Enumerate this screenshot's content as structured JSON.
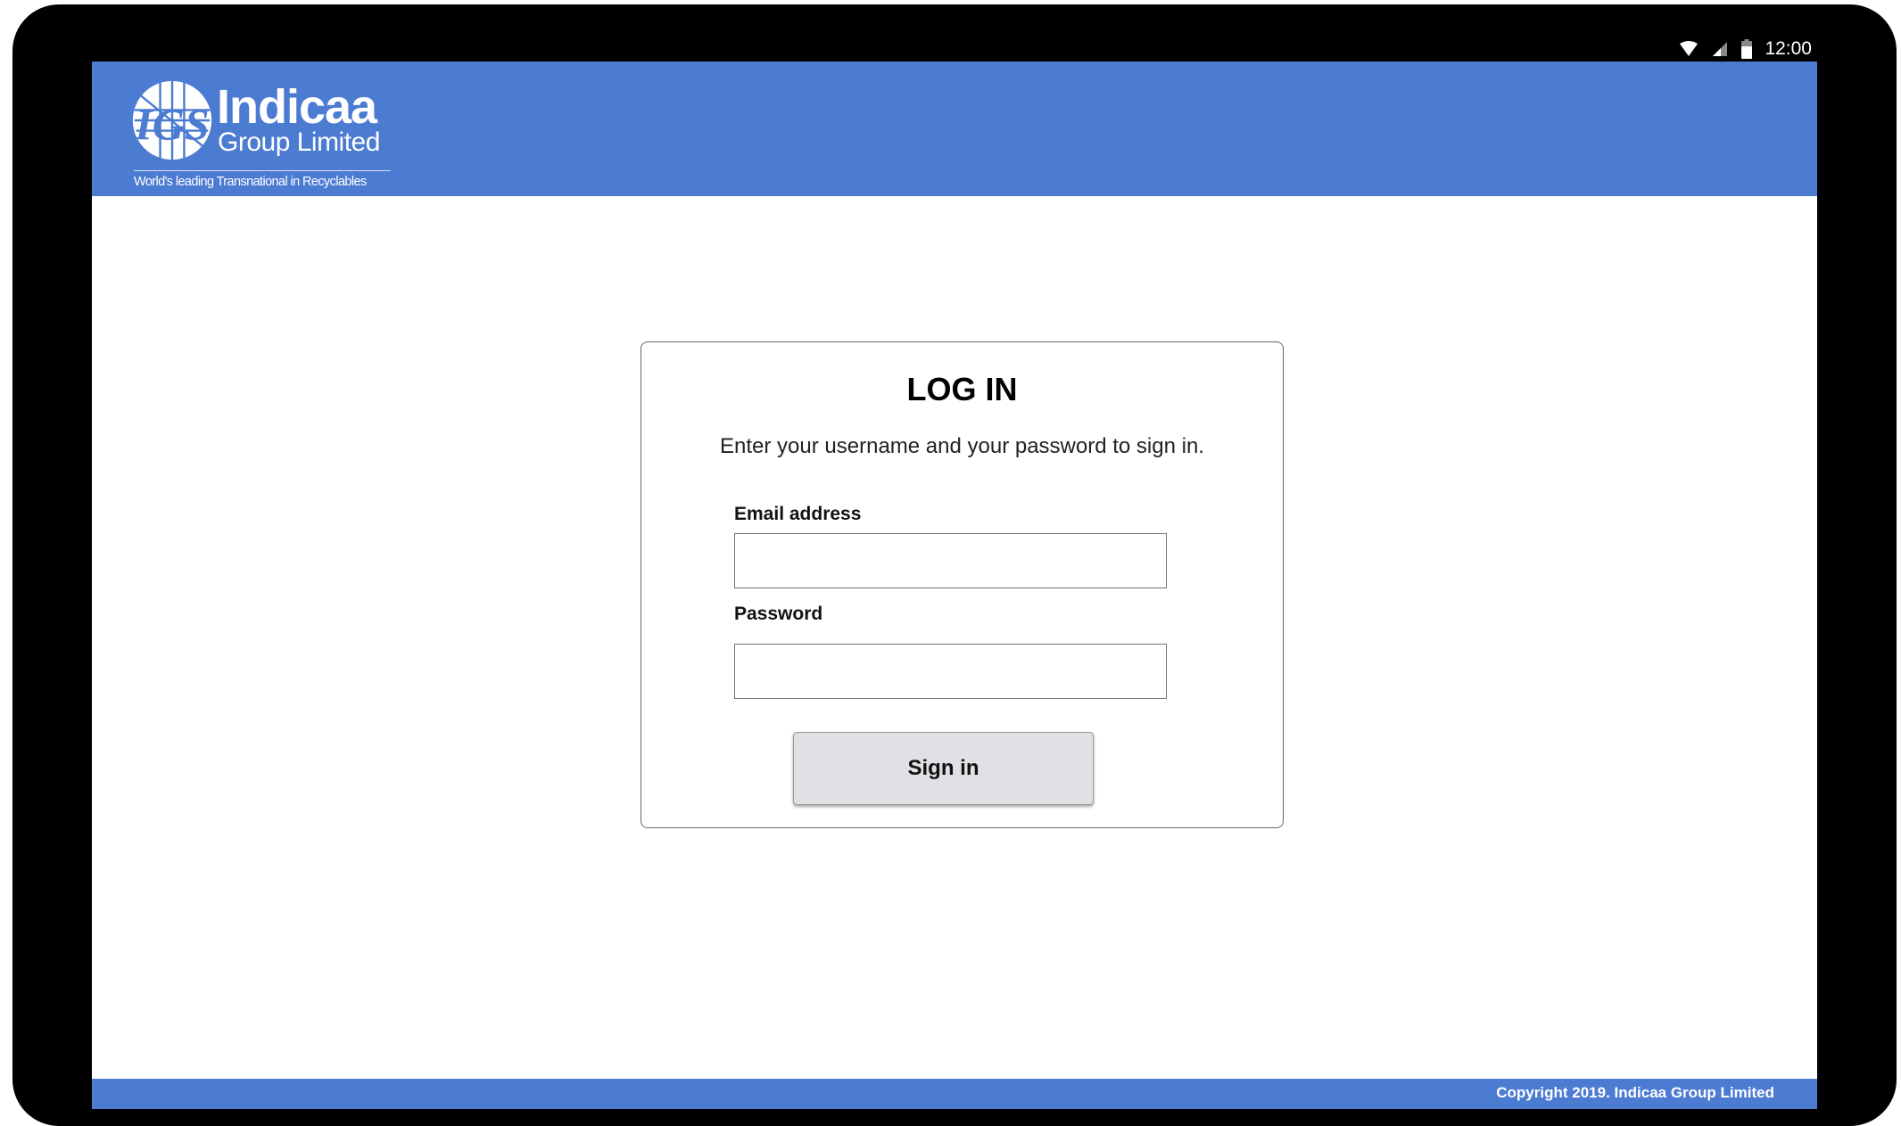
{
  "status_bar": {
    "time": "12:00",
    "icons": [
      "wifi-icon",
      "signal-icon",
      "battery-icon"
    ]
  },
  "header": {
    "logo": {
      "monogram": "IGS",
      "brand": "Indicaa",
      "subtitle": "Group Limited",
      "tagline": "World's leading Transnational in Recyclables"
    },
    "background_color": "#4c7bd2"
  },
  "login": {
    "title": "LOG IN",
    "subtitle": "Enter your username and your password to sign in.",
    "email_label": "Email address",
    "email_value": "",
    "password_label": "Password",
    "password_value": "",
    "submit_label": "Sign in"
  },
  "footer": {
    "copyright": "Copyright 2019. Indicaa Group Limited",
    "background_color": "#4c7bd2"
  }
}
